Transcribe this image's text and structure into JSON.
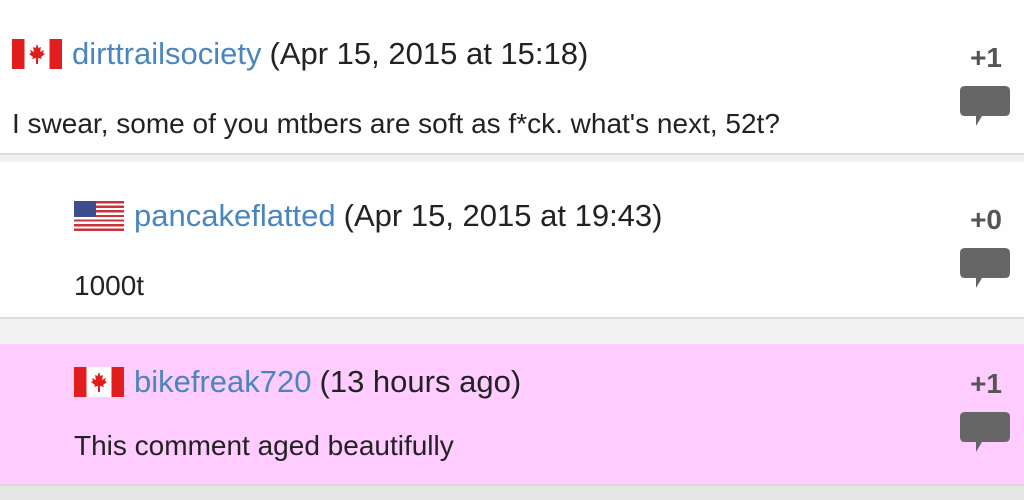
{
  "colors": {
    "username": "#4a86bd",
    "highlight_bg": "#ffccff",
    "score": "#555555"
  },
  "comments": [
    {
      "flag": "canada-flag-icon",
      "username": "dirttrailsociety",
      "date": "(Apr 15, 2015 at 15:18)",
      "body": "I swear, some of you mtbers are soft as f*ck. what's next, 52t?",
      "score": "+1",
      "reply_icon": "speech-bubble-icon"
    },
    {
      "flag": "usa-flag-icon",
      "username": "pancakeflatted",
      "date": "(Apr 15, 2015 at 19:43)",
      "body": "1000t",
      "score": "+0",
      "reply_icon": "speech-bubble-icon"
    },
    {
      "flag": "canada-flag-icon",
      "username": "bikefreak720",
      "date": "(13 hours ago)",
      "body": "This comment aged beautifully",
      "score": "+1",
      "reply_icon": "speech-bubble-icon",
      "highlighted": true
    }
  ]
}
